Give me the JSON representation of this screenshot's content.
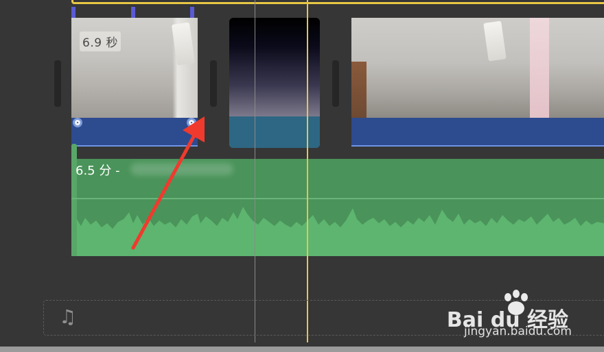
{
  "timeline": {
    "clip1_duration": "6.9 秒",
    "audio_label": "6.5 分 -",
    "music_icon": "music-note-icon"
  },
  "watermark": {
    "logo_text": "Bai  du 经验",
    "url": "jingyan.baidu.com"
  },
  "colors": {
    "playhead": "#e8c64a",
    "selection": "#e9c845",
    "audio_track": "#4a935a",
    "clip_strip": "#2d4b8f",
    "annotation_arrow": "#f03a2e"
  }
}
